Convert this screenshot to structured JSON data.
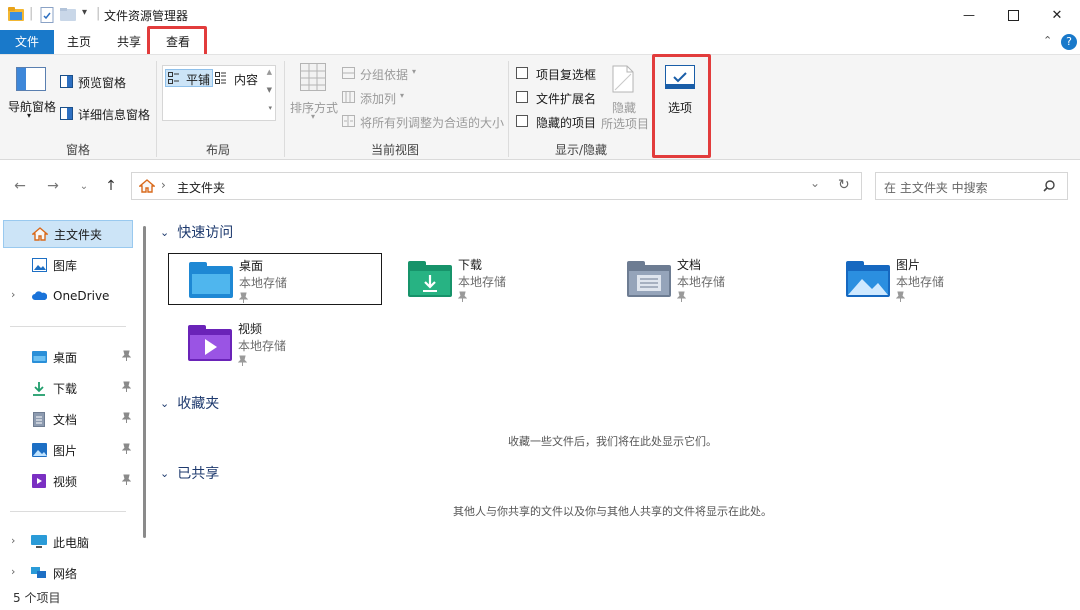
{
  "window": {
    "title": "文件资源管理器",
    "min_symbol": "—",
    "max_symbol": "☐",
    "close_symbol": "✕"
  },
  "tabs": {
    "file": "文件",
    "home": "主页",
    "share": "共享",
    "view": "查看"
  },
  "ribbon": {
    "nav_pane": "导航窗格",
    "preview_pane": "预览窗格",
    "details_pane": "详细信息窗格",
    "pane_group": "窗格",
    "layout_tile": "平铺",
    "layout_content": "内容",
    "layout_group": "布局",
    "sort_by": "排序方式",
    "group_by": "分组依据",
    "add_column": "添加列",
    "fit_columns": "将所有列调整为合适的大小",
    "current_view_group": "当前视图",
    "item_checkboxes": "项目复选框",
    "file_extensions": "文件扩展名",
    "hidden_items": "隐藏的项目",
    "hide_selected_line1": "隐藏",
    "hide_selected_line2": "所选项目",
    "show_hide_group": "显示/隐藏",
    "options": "选项"
  },
  "address": {
    "path": "主文件夹",
    "search_placeholder": "在 主文件夹 中搜索"
  },
  "nav": {
    "home": "主文件夹",
    "gallery": "图库",
    "onedrive": "OneDrive",
    "desktop": "桌面",
    "downloads": "下载",
    "documents": "文档",
    "pictures": "图片",
    "videos": "视频",
    "this_pc": "此电脑",
    "network": "网络"
  },
  "content": {
    "quick_access": "快速访问",
    "favorites": "收藏夹",
    "shared": "已共享",
    "favorites_empty": "收藏一些文件后，我们将在此处显示它们。",
    "shared_empty": "其他人与你共享的文件以及你与其他人共享的文件将显示在此处。",
    "tiles": [
      {
        "name": "桌面",
        "sub": "本地存储"
      },
      {
        "name": "下载",
        "sub": "本地存储"
      },
      {
        "name": "文档",
        "sub": "本地存储"
      },
      {
        "name": "图片",
        "sub": "本地存储"
      },
      {
        "name": "视频",
        "sub": "本地存储"
      }
    ]
  },
  "status": {
    "count": "5 个项目"
  },
  "colors": {
    "accent": "#1979ca",
    "highlight": "#e23c3c",
    "section_heading": "#1e3a6e"
  }
}
